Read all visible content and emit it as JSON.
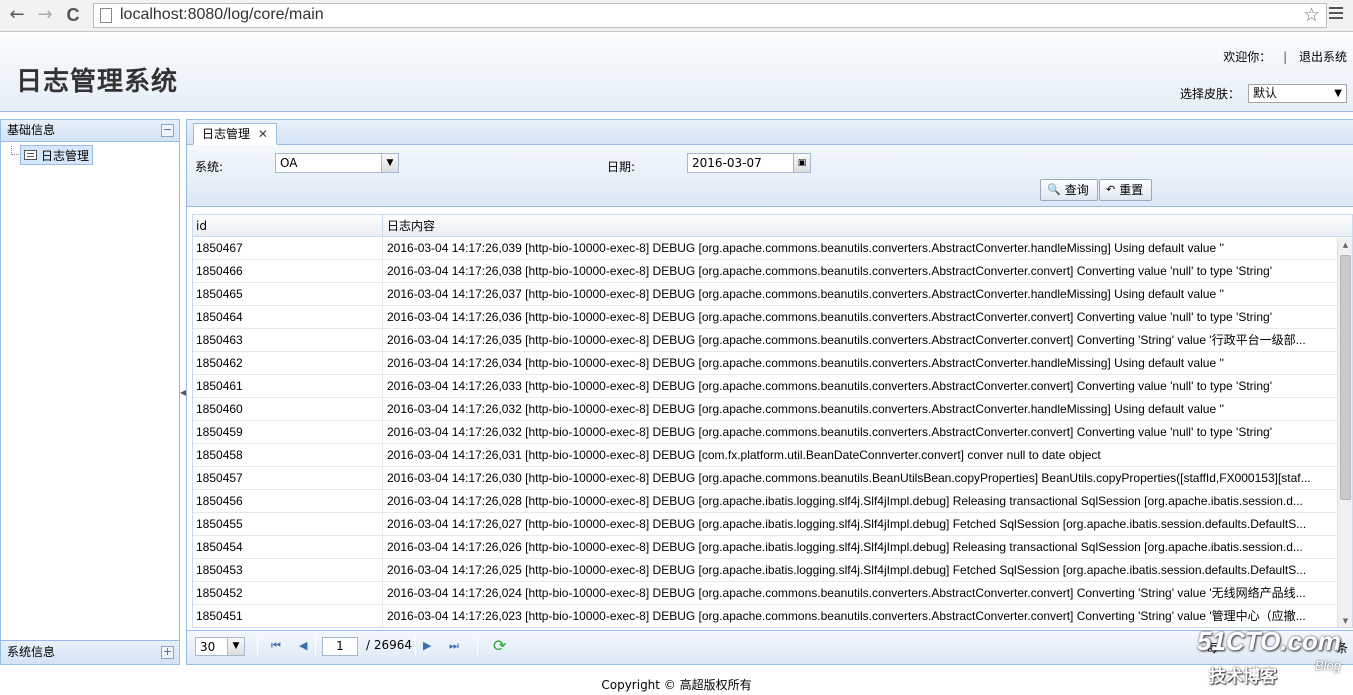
{
  "browser": {
    "url": "localhost:8080/log/core/main",
    "back_glyph": "←",
    "forward_glyph": "→",
    "reload_glyph": "C",
    "star_glyph": "☆"
  },
  "header": {
    "title": "日志管理系统",
    "welcome": "欢迎你：",
    "separator": "|",
    "logout": "退出系统",
    "skin_label": "选择皮肤：",
    "skin_value": "默认"
  },
  "west": {
    "title": "基础信息",
    "collapse_glyph": "−",
    "tree_item": "日志管理",
    "footer_title": "系统信息",
    "expand_glyph": "+"
  },
  "center": {
    "tab_label": "日志管理",
    "tab_close": "✕",
    "search": {
      "system_label": "系统:",
      "system_value": "OA",
      "date_label": "日期:",
      "date_value": "2016-03-07",
      "query_button": "查询",
      "reset_button": "重置"
    },
    "grid": {
      "columns": [
        "id",
        "日志内容"
      ],
      "rows": [
        {
          "id": "1850467",
          "content": "2016-03-04 14:17:26,039 [http-bio-10000-exec-8] DEBUG [org.apache.commons.beanutils.converters.AbstractConverter.handleMissing] Using default value ''"
        },
        {
          "id": "1850466",
          "content": "2016-03-04 14:17:26,038 [http-bio-10000-exec-8] DEBUG [org.apache.commons.beanutils.converters.AbstractConverter.convert] Converting value 'null' to type 'String'"
        },
        {
          "id": "1850465",
          "content": "2016-03-04 14:17:26,037 [http-bio-10000-exec-8] DEBUG [org.apache.commons.beanutils.converters.AbstractConverter.handleMissing] Using default value ''"
        },
        {
          "id": "1850464",
          "content": "2016-03-04 14:17:26,036 [http-bio-10000-exec-8] DEBUG [org.apache.commons.beanutils.converters.AbstractConverter.convert] Converting value 'null' to type 'String'"
        },
        {
          "id": "1850463",
          "content": "2016-03-04 14:17:26,035 [http-bio-10000-exec-8] DEBUG [org.apache.commons.beanutils.converters.AbstractConverter.convert] Converting 'String' value '行政平台一级部..."
        },
        {
          "id": "1850462",
          "content": "2016-03-04 14:17:26,034 [http-bio-10000-exec-8] DEBUG [org.apache.commons.beanutils.converters.AbstractConverter.handleMissing] Using default value ''"
        },
        {
          "id": "1850461",
          "content": "2016-03-04 14:17:26,033 [http-bio-10000-exec-8] DEBUG [org.apache.commons.beanutils.converters.AbstractConverter.convert] Converting value 'null' to type 'String'"
        },
        {
          "id": "1850460",
          "content": "2016-03-04 14:17:26,032 [http-bio-10000-exec-8] DEBUG [org.apache.commons.beanutils.converters.AbstractConverter.handleMissing] Using default value ''"
        },
        {
          "id": "1850459",
          "content": "2016-03-04 14:17:26,032 [http-bio-10000-exec-8] DEBUG [org.apache.commons.beanutils.converters.AbstractConverter.convert] Converting value 'null' to type 'String'"
        },
        {
          "id": "1850458",
          "content": "2016-03-04 14:17:26,031 [http-bio-10000-exec-8] DEBUG [com.fx.platform.util.BeanDateConnverter.convert] conver null to date object"
        },
        {
          "id": "1850457",
          "content": "2016-03-04 14:17:26,030 [http-bio-10000-exec-8] DEBUG [org.apache.commons.beanutils.BeanUtilsBean.copyProperties] BeanUtils.copyProperties([staffId,FX000153][staf..."
        },
        {
          "id": "1850456",
          "content": "2016-03-04 14:17:26,028 [http-bio-10000-exec-8] DEBUG [org.apache.ibatis.logging.slf4j.Slf4jImpl.debug] Releasing transactional SqlSession [org.apache.ibatis.session.d..."
        },
        {
          "id": "1850455",
          "content": "2016-03-04 14:17:26,027 [http-bio-10000-exec-8] DEBUG [org.apache.ibatis.logging.slf4j.Slf4jImpl.debug] Fetched SqlSession [org.apache.ibatis.session.defaults.DefaultS..."
        },
        {
          "id": "1850454",
          "content": "2016-03-04 14:17:26,026 [http-bio-10000-exec-8] DEBUG [org.apache.ibatis.logging.slf4j.Slf4jImpl.debug] Releasing transactional SqlSession [org.apache.ibatis.session.d..."
        },
        {
          "id": "1850453",
          "content": "2016-03-04 14:17:26,025 [http-bio-10000-exec-8] DEBUG [org.apache.ibatis.logging.slf4j.Slf4jImpl.debug] Fetched SqlSession [org.apache.ibatis.session.defaults.DefaultS..."
        },
        {
          "id": "1850452",
          "content": "2016-03-04 14:17:26,024 [http-bio-10000-exec-8] DEBUG [org.apache.commons.beanutils.converters.AbstractConverter.convert] Converting 'String' value '无线网络产品线..."
        },
        {
          "id": "1850451",
          "content": "2016-03-04 14:17:26,023 [http-bio-10000-exec-8] DEBUG [org.apache.commons.beanutils.converters.AbstractConverter.convert] Converting 'String' value '管理中心（应撤..."
        }
      ]
    },
    "pager": {
      "page_size": "30",
      "current_page": "1",
      "total_pages": "/ 26964",
      "first_glyph": "⏮",
      "prev_glyph": "◀",
      "next_glyph": "▶",
      "last_glyph": "⏭",
      "refresh_glyph": "⟳",
      "right_text": "每",
      "right_text_end": "条"
    }
  },
  "footer": {
    "copyright": "Copyright © 高超版权所有"
  },
  "watermark": {
    "site": "51CTO.com",
    "caption": "技术博客",
    "blog": "Blog"
  }
}
